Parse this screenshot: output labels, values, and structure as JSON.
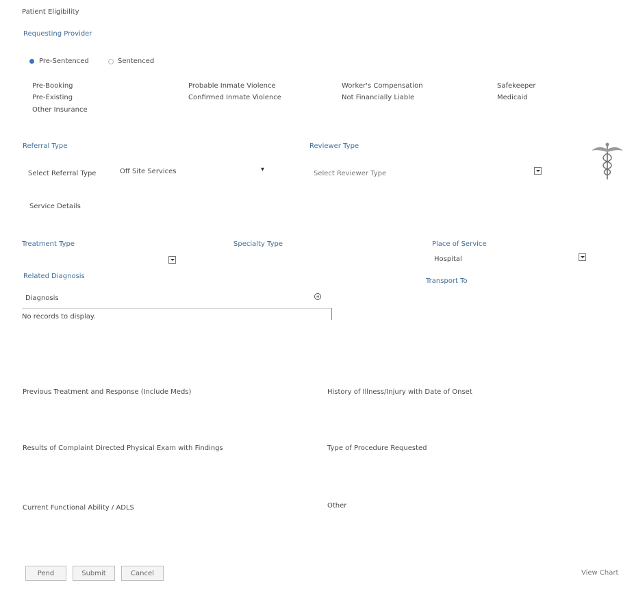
{
  "header": {
    "title": "Patient Eligibility",
    "requesting_provider": "Requesting Provider"
  },
  "status_radios": {
    "pre_sentenced": "Pre-Sentenced",
    "sentenced": "Sentenced"
  },
  "eligibility_flags": {
    "col1": [
      "Pre-Booking",
      "Pre-Existing",
      "Other Insurance"
    ],
    "col2": [
      "Probable Inmate Violence",
      "Confirmed Inmate Violence"
    ],
    "col3": [
      "Worker's Compensation",
      "Not Financially Liable"
    ],
    "col4": [
      "Safekeeper",
      "Medicaid"
    ]
  },
  "referral": {
    "label": "Referral Type",
    "select_label": "Select Referral Type",
    "value": "Off Site Services"
  },
  "reviewer": {
    "label": "Reviewer Type",
    "placeholder": "Select Reviewer Type"
  },
  "caduceus_icon": "caduceus-icon",
  "service_details": {
    "label": "Service Details"
  },
  "treatment": {
    "label": "Treatment Type",
    "value": ""
  },
  "specialty": {
    "label": "Specialty Type"
  },
  "place": {
    "label": "Place of Service",
    "value": "Hospital"
  },
  "diagnosis": {
    "related_label": "Related Diagnosis",
    "column_header": "Diagnosis",
    "empty_message": "No records to display."
  },
  "transport": {
    "label": "Transport To"
  },
  "fields": {
    "previous_treatment": "Previous Treatment and Response (Include Meds)",
    "history": "History of Illness/Injury with Date of Onset",
    "results": "Results of Complaint Directed Physical Exam with Findings",
    "procedure": "Type of Procedure Requested",
    "functional": "Current Functional Ability / ADLS",
    "other": "Other"
  },
  "footer": {
    "pend": "Pend",
    "submit": "Submit",
    "cancel": "Cancel",
    "view_chart": "View Chart"
  }
}
